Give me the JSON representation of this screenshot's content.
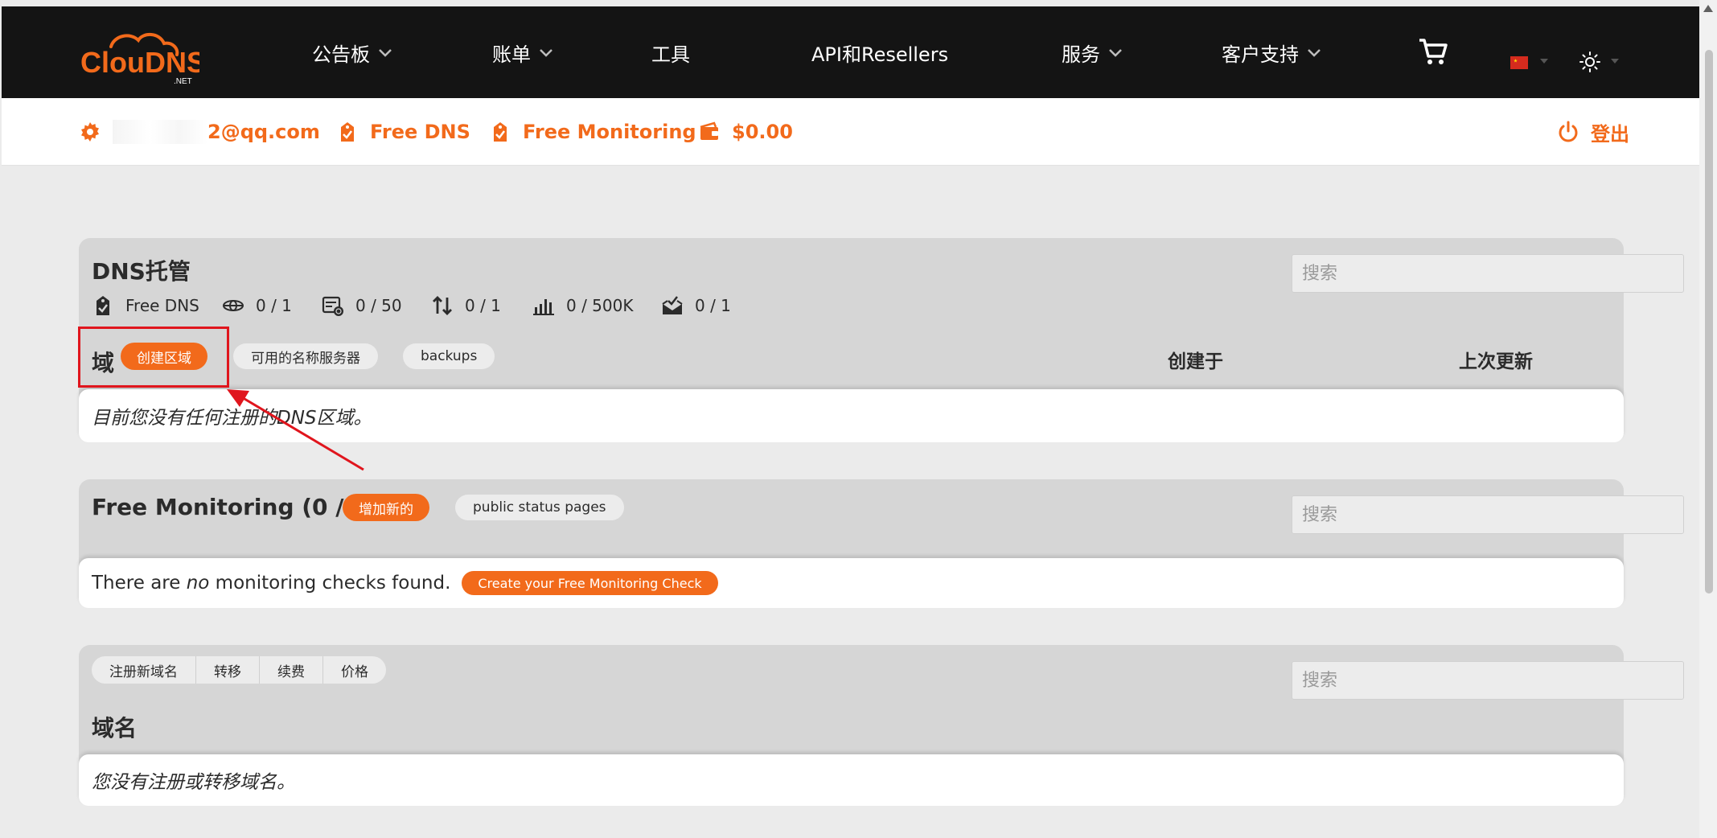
{
  "brand": {
    "logo_text": "ClouDNS",
    "logo_sub": ".NET",
    "accent_color": "#f26a1b",
    "nav_bg": "#141414"
  },
  "nav": {
    "items": [
      {
        "label": "公告板",
        "has_dropdown": true
      },
      {
        "label": "账单",
        "has_dropdown": true
      },
      {
        "label": "工具",
        "has_dropdown": false
      },
      {
        "label": "API和Resellers",
        "has_dropdown": false
      },
      {
        "label": "服务",
        "has_dropdown": true
      },
      {
        "label": "客户支持",
        "has_dropdown": true
      }
    ],
    "icons": [
      "cart-icon",
      "china-flag-icon",
      "sun-icon"
    ]
  },
  "account_bar": {
    "email_suffix": "2@qq.com",
    "plan_dns": "Free DNS",
    "plan_monitoring": "Free Monitoring",
    "balance": "$0.00",
    "logout": "登出"
  },
  "dns_panel": {
    "title": "DNS托管",
    "search_placeholder": "搜索",
    "stats": [
      {
        "icon": "tag-check-icon",
        "value": "Free DNS"
      },
      {
        "icon": "globe-icon",
        "value": "0 / 1"
      },
      {
        "icon": "server-globe-icon",
        "value": "0 / 50"
      },
      {
        "icon": "transfer-arrows-icon",
        "value": "0 / 1"
      },
      {
        "icon": "bar-chart-icon",
        "value": "0 / 500K"
      },
      {
        "icon": "mail-check-icon",
        "value": "0 / 1"
      }
    ],
    "domain_label": "域",
    "create_zone_button": "创建区域",
    "nameservers_button": "可用的名称服务器",
    "backups_button": "backups",
    "col_created": "创建于",
    "col_updated": "上次更新",
    "empty_message": "目前您没有任何注册的DNS区域。"
  },
  "monitoring_panel": {
    "title": "Free Monitoring (0 / 1)",
    "add_button": "增加新的",
    "status_pages_button": "public status pages",
    "search_placeholder": "搜索",
    "empty_prefix": "There are ",
    "empty_italic": "no",
    "empty_suffix": " monitoring checks found.",
    "create_button": "Create your Free Monitoring Check"
  },
  "domains_panel": {
    "tabs": [
      "注册新域名",
      "转移",
      "续费",
      "价格"
    ],
    "search_placeholder": "搜索",
    "title": "域名",
    "empty_message": "您没有注册或转移域名。"
  }
}
